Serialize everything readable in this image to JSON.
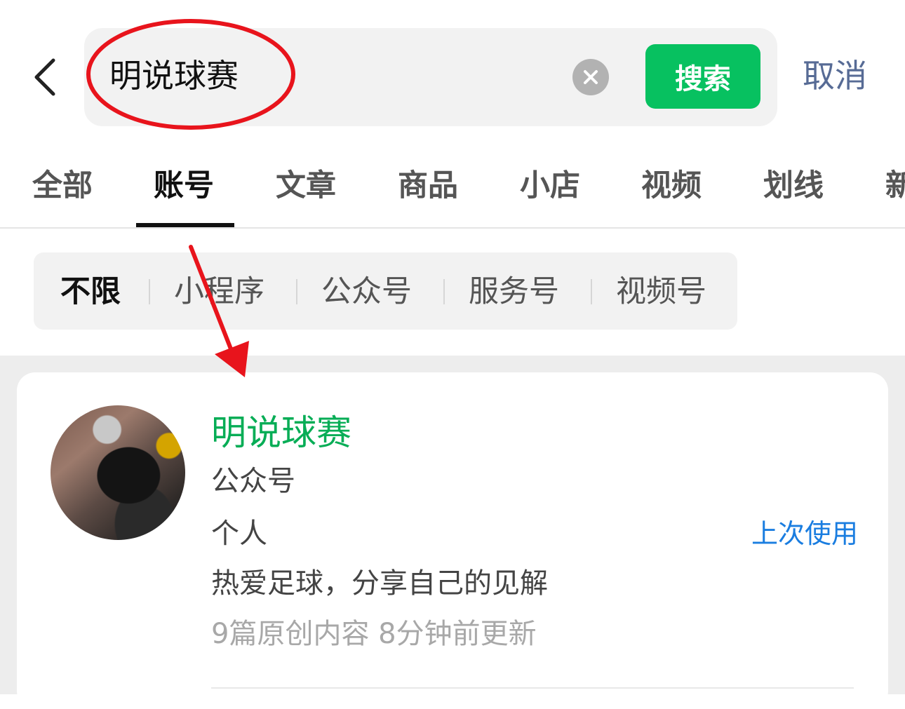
{
  "search": {
    "query": "明说球赛",
    "submit_label": "搜索",
    "cancel_label": "取消",
    "accent_color": "#07c160"
  },
  "tabs": [
    {
      "label": "全部"
    },
    {
      "label": "账号",
      "active": true
    },
    {
      "label": "文章"
    },
    {
      "label": "商品"
    },
    {
      "label": "小店"
    },
    {
      "label": "视频"
    },
    {
      "label": "划线"
    },
    {
      "label": "新"
    }
  ],
  "filters": [
    {
      "label": "不限",
      "active": true
    },
    {
      "label": "小程序"
    },
    {
      "label": "公众号"
    },
    {
      "label": "服务号"
    },
    {
      "label": "视频号"
    }
  ],
  "result": {
    "name": "明说球赛",
    "type": "公众号",
    "kind": "个人",
    "last_used": "上次使用",
    "description": "热爱足球，分享自己的见解",
    "meta": "9篇原创内容  8分钟前更新",
    "name_color": "#07ad56"
  },
  "annotation_color": "#e8141c"
}
